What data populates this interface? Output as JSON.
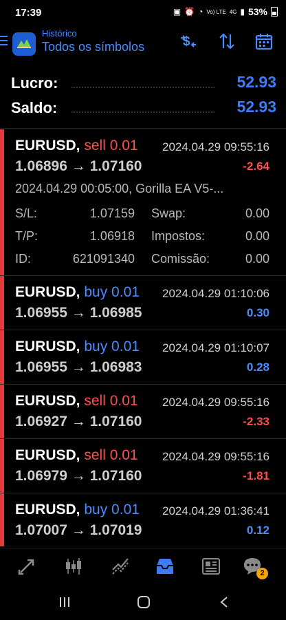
{
  "status": {
    "time": "17:39",
    "network": "Vo) LTE",
    "network_gen": "4G",
    "battery": "53%"
  },
  "header": {
    "subtitle": "Histórico",
    "title": "Todos os símbolos",
    "logo_icon": "metatrader-logo",
    "actions": [
      "currency-filter-icon",
      "sort-icon",
      "calendar-icon"
    ]
  },
  "summary": {
    "profit_label": "Lucro:",
    "profit_value": "52.93",
    "balance_label": "Saldo:",
    "balance_value": "52.93"
  },
  "trades": [
    {
      "symbol": "EURUSD,",
      "type": "sell 0.01",
      "side": "sell",
      "time": "2024.04.29 09:55:16",
      "prices": "1.06896 → 1.07160",
      "profit": "-2.64",
      "expanded": true,
      "comment": "2024.04.29 00:05:00, Gorilla EA V5-...",
      "sl_label": "S/L:",
      "sl_value": "1.07159",
      "swap_label": "Swap:",
      "swap_value": "0.00",
      "tp_label": "T/P:",
      "tp_value": "1.06918",
      "tax_label": "Impostos:",
      "tax_value": "0.00",
      "id_label": "ID:",
      "id_value": "621091340",
      "commission_label": "Comissão:",
      "commission_value": "0.00"
    },
    {
      "symbol": "EURUSD,",
      "type": "buy 0.01",
      "side": "buy",
      "time": "2024.04.29 01:10:06",
      "prices": "1.06955 → 1.06985",
      "profit": "0.30"
    },
    {
      "symbol": "EURUSD,",
      "type": "buy 0.01",
      "side": "buy",
      "time": "2024.04.29 01:10:07",
      "prices": "1.06955 → 1.06983",
      "profit": "0.28"
    },
    {
      "symbol": "EURUSD,",
      "type": "sell 0.01",
      "side": "sell",
      "time": "2024.04.29 09:55:16",
      "prices": "1.06927 → 1.07160",
      "profit": "-2.33"
    },
    {
      "symbol": "EURUSD,",
      "type": "sell 0.01",
      "side": "sell",
      "time": "2024.04.29 09:55:16",
      "prices": "1.06979 → 1.07160",
      "profit": "-1.81"
    },
    {
      "symbol": "EURUSD,",
      "type": "buy 0.01",
      "side": "buy",
      "time": "2024.04.29 01:36:41",
      "prices": "1.07007 → 1.07019",
      "profit": "0.12"
    }
  ],
  "bottom_nav": {
    "items": [
      "quotes-icon",
      "chart-icon",
      "trade-icon",
      "history-icon",
      "news-icon",
      "chat-icon"
    ],
    "active": "history-icon",
    "chat_badge": "2"
  },
  "colors": {
    "accent": "#4a8cff",
    "sell": "#ff4d4d",
    "sell_bar": "#e23b3b",
    "background": "#000000"
  }
}
